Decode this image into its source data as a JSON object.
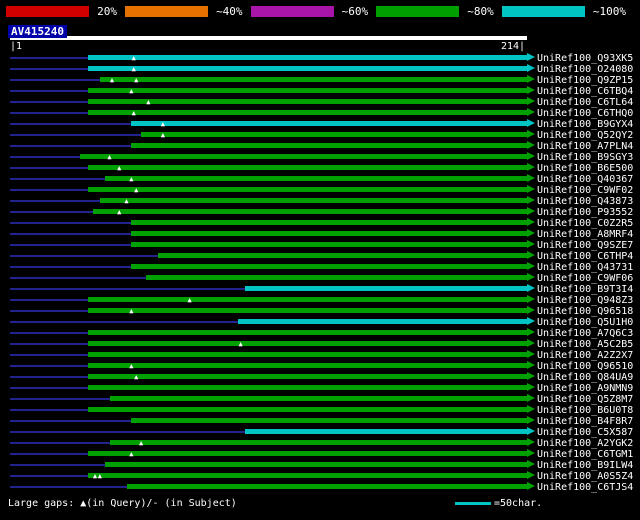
{
  "colors": {
    "background": "#000000",
    "baseline": "#23238e",
    "green": "#00a000",
    "cyan": "#00c3c3",
    "red": "#d10000",
    "orange": "#e57200",
    "purple": "#a915a9",
    "white": "#ffffff",
    "query_highlight": "#0000a8"
  },
  "scale_bar": {
    "items": [
      {
        "swatch": "#d10000",
        "name": "scale-swatch-red"
      },
      {
        "label": "20%"
      },
      {
        "swatch": "#e57200",
        "name": "scale-swatch-orange"
      },
      {
        "label": "~40%"
      },
      {
        "swatch": "#a915a9",
        "name": "scale-swatch-purple"
      },
      {
        "label": "~60%"
      },
      {
        "swatch": "#00a000",
        "name": "scale-swatch-green"
      },
      {
        "label": "~80%"
      },
      {
        "swatch": "#00c3c3",
        "name": "scale-swatch-cyan"
      },
      {
        "label": "~100%"
      }
    ]
  },
  "query": {
    "name": "AV415240",
    "start_label": "|1",
    "end_label": "214|"
  },
  "footer": {
    "gaps_note": "Large gaps: ▲(in Query)/- (in Subject)",
    "scale_note": "=50char."
  },
  "chart_data": {
    "type": "bar",
    "subtype": "blast-alignment-overview",
    "title": "AV415240",
    "axis": {
      "min": 1,
      "max": 214,
      "tick_labels": [
        "|1",
        "214|"
      ]
    },
    "legend": {
      "colors_mean_identity": [
        "20%",
        "~40%",
        "~60%",
        "~80%",
        "~100%"
      ],
      "line_scale": "=50char."
    },
    "rows": [
      {
        "label": "UniRef100_Q93XK5",
        "color": "cyan",
        "start": 33,
        "end": 214,
        "gaps": [
          52
        ]
      },
      {
        "label": "UniRef100_O24080",
        "color": "cyan",
        "start": 33,
        "end": 214,
        "gaps": [
          52
        ]
      },
      {
        "label": "UniRef100_Q9ZP15",
        "color": "green",
        "start": 38,
        "end": 214,
        "gaps": [
          43,
          53
        ]
      },
      {
        "label": "UniRef100_C6TBQ4",
        "color": "green",
        "start": 33,
        "end": 214,
        "gaps": [
          51
        ]
      },
      {
        "label": "UniRef100_C6TL64",
        "color": "green",
        "start": 33,
        "end": 214,
        "gaps": [
          58
        ]
      },
      {
        "label": "UniRef100_C6THQ0",
        "color": "green",
        "start": 33,
        "end": 214,
        "gaps": [
          52
        ]
      },
      {
        "label": "UniRef100_B9GYX4",
        "color": "cyan",
        "start": 51,
        "end": 214,
        "gaps": [
          64
        ]
      },
      {
        "label": "UniRef100_Q52QY2",
        "color": "green",
        "start": 55,
        "end": 214,
        "gaps": [
          64
        ]
      },
      {
        "label": "UniRef100_A7PLN4",
        "color": "green",
        "start": 51,
        "end": 214,
        "gaps": []
      },
      {
        "label": "UniRef100_B9SGY3",
        "color": "green",
        "start": 30,
        "end": 214,
        "gaps": [
          42
        ]
      },
      {
        "label": "UniRef100_B6E500",
        "color": "green",
        "start": 33,
        "end": 214,
        "gaps": [
          46
        ]
      },
      {
        "label": "UniRef100_Q40367",
        "color": "green",
        "start": 40,
        "end": 214,
        "gaps": [
          51
        ]
      },
      {
        "label": "UniRef100_C9WF02",
        "color": "green",
        "start": 33,
        "end": 214,
        "gaps": [
          53
        ]
      },
      {
        "label": "UniRef100_Q43873",
        "color": "green",
        "start": 38,
        "end": 214,
        "gaps": [
          49
        ]
      },
      {
        "label": "UniRef100_P93552",
        "color": "green",
        "start": 35,
        "end": 214,
        "gaps": [
          46
        ]
      },
      {
        "label": "UniRef100_C0Z2R5",
        "color": "green",
        "start": 51,
        "end": 214,
        "gaps": []
      },
      {
        "label": "UniRef100_A8MRF4",
        "color": "green",
        "start": 51,
        "end": 214,
        "gaps": []
      },
      {
        "label": "UniRef100_Q9SZE7",
        "color": "green",
        "start": 51,
        "end": 214,
        "gaps": []
      },
      {
        "label": "UniRef100_C6THP4",
        "color": "green",
        "start": 62,
        "end": 214,
        "gaps": []
      },
      {
        "label": "UniRef100_Q43731",
        "color": "green",
        "start": 51,
        "end": 214,
        "gaps": []
      },
      {
        "label": "UniRef100_C9WF06",
        "color": "green",
        "start": 57,
        "end": 214,
        "gaps": []
      },
      {
        "label": "UniRef100_B9T3I4",
        "color": "cyan",
        "start": 98,
        "end": 214,
        "gaps": []
      },
      {
        "label": "UniRef100_Q948Z3",
        "color": "green",
        "start": 33,
        "end": 214,
        "gaps": [
          75
        ]
      },
      {
        "label": "UniRef100_Q96518",
        "color": "green",
        "start": 33,
        "end": 214,
        "gaps": [
          51
        ]
      },
      {
        "label": "UniRef100_Q5U1H0",
        "color": "cyan",
        "start": 95,
        "end": 214,
        "gaps": []
      },
      {
        "label": "UniRef100_A7Q6C3",
        "color": "green",
        "start": 33,
        "end": 214,
        "gaps": []
      },
      {
        "label": "UniRef100_A5C2B5",
        "color": "green",
        "start": 33,
        "end": 214,
        "gaps": [
          96
        ]
      },
      {
        "label": "UniRef100_A2Z2X7",
        "color": "green",
        "start": 33,
        "end": 214,
        "gaps": []
      },
      {
        "label": "UniRef100_Q96510",
        "color": "green",
        "start": 33,
        "end": 214,
        "gaps": [
          51
        ]
      },
      {
        "label": "UniRef100_Q84UA9",
        "color": "green",
        "start": 33,
        "end": 214,
        "gaps": [
          53
        ]
      },
      {
        "label": "UniRef100_A9NMN9",
        "color": "green",
        "start": 33,
        "end": 214,
        "gaps": []
      },
      {
        "label": "UniRef100_Q5Z8M7",
        "color": "green",
        "start": 42,
        "end": 214,
        "gaps": []
      },
      {
        "label": "UniRef100_B6U0T8",
        "color": "green",
        "start": 33,
        "end": 214,
        "gaps": []
      },
      {
        "label": "UniRef100_B4F8R7",
        "color": "green",
        "start": 51,
        "end": 214,
        "gaps": []
      },
      {
        "label": "UniRef100_C5X587",
        "color": "cyan",
        "start": 98,
        "end": 214,
        "gaps": []
      },
      {
        "label": "UniRef100_A2YGK2",
        "color": "green",
        "start": 42,
        "end": 214,
        "gaps": [
          55
        ]
      },
      {
        "label": "UniRef100_C6TGM1",
        "color": "green",
        "start": 33,
        "end": 214,
        "gaps": [
          51
        ]
      },
      {
        "label": "UniRef100_B9ILW4",
        "color": "green",
        "start": 40,
        "end": 214,
        "gaps": []
      },
      {
        "label": "UniRef100_A0S5Z4",
        "color": "green",
        "start": 33,
        "end": 214,
        "gaps": [
          36,
          38
        ]
      },
      {
        "label": "UniRef100_C6TJS4",
        "color": "green",
        "start": 49,
        "end": 214,
        "gaps": []
      }
    ]
  }
}
